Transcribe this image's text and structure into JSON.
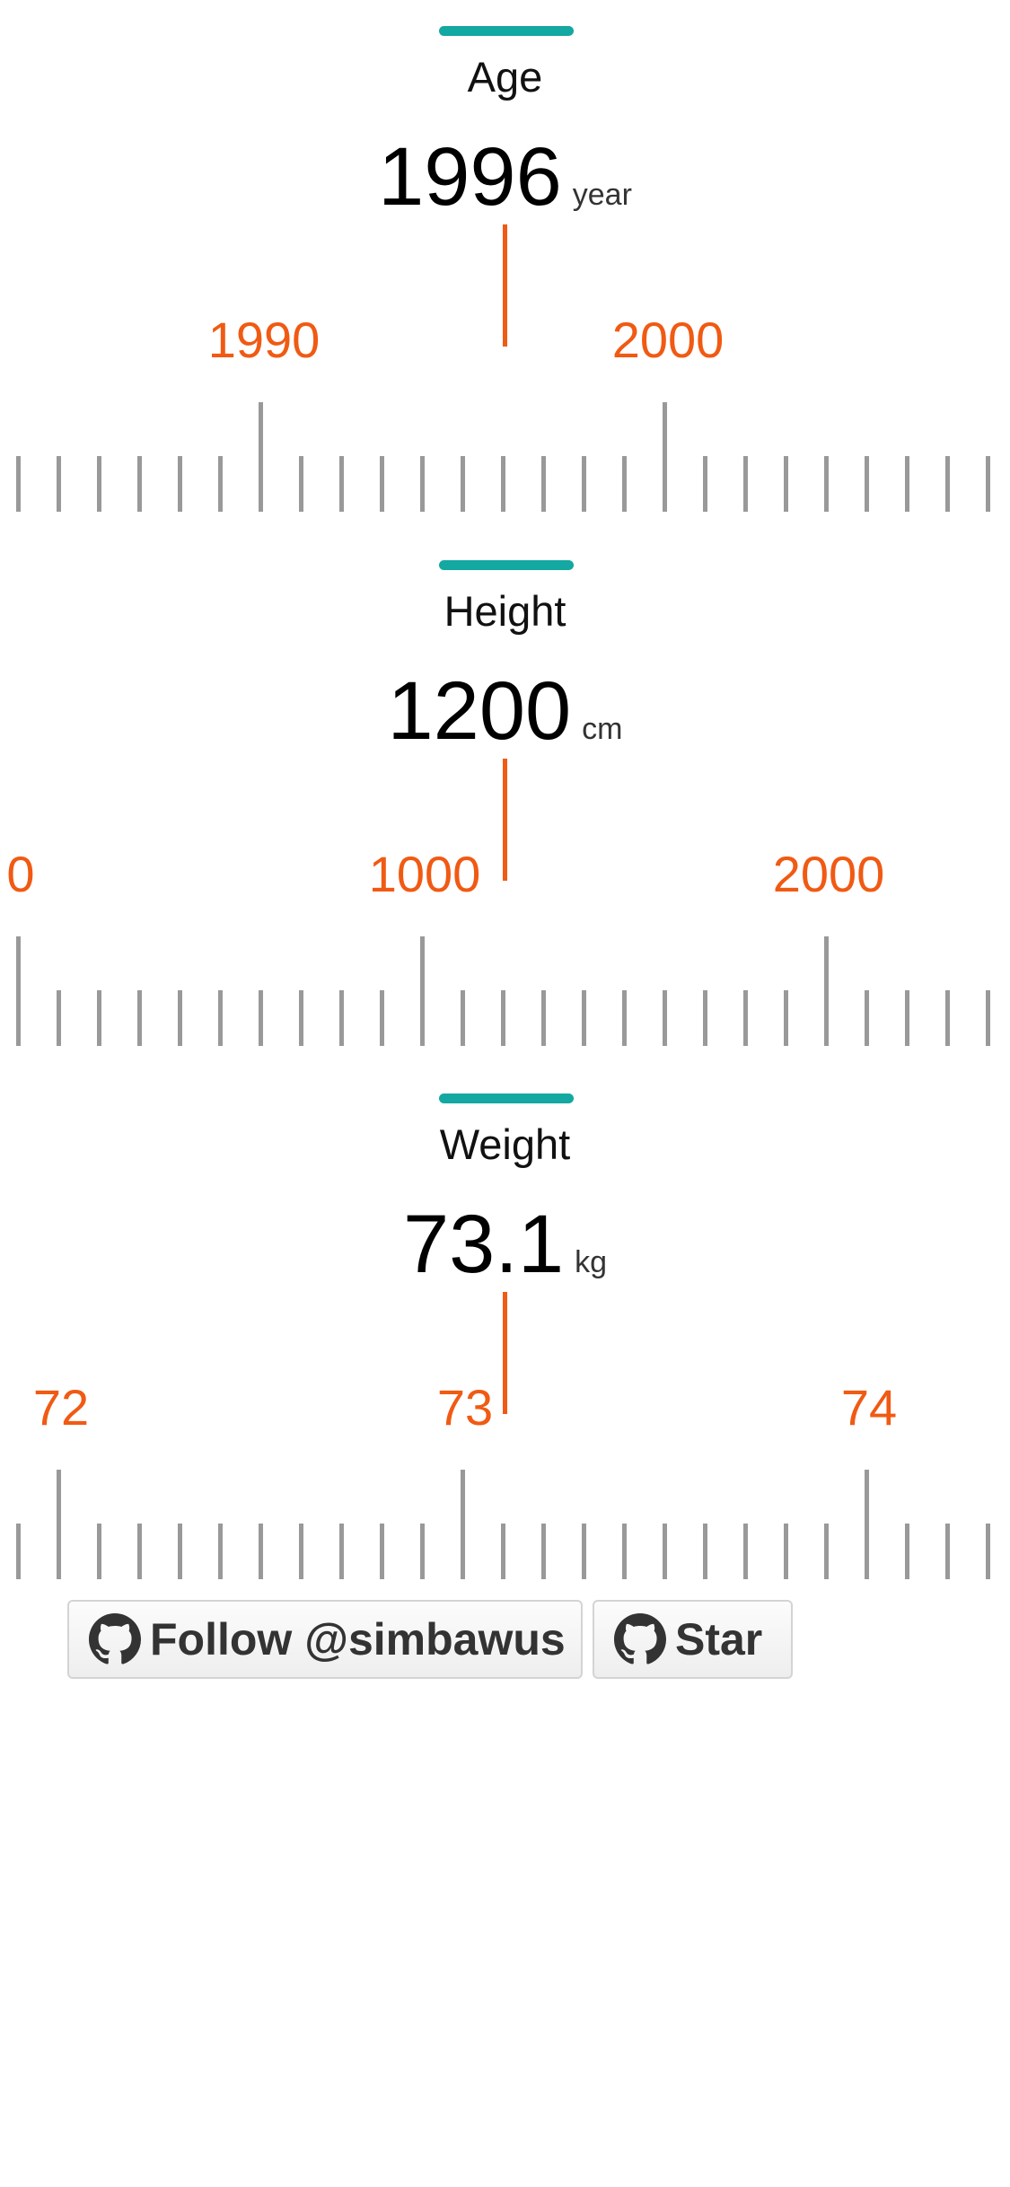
{
  "colors": {
    "accent": "#13a8a1",
    "pointer": "#f05a13",
    "tick": "#999999",
    "label": "#f05a13"
  },
  "rulers": [
    {
      "title": "Age",
      "value": "1996",
      "unit": "year",
      "labels": [
        "1990",
        "2000"
      ]
    },
    {
      "title": "Height",
      "value": "1200",
      "unit": "cm",
      "labels": [
        "0",
        "1000",
        "2000"
      ]
    },
    {
      "title": "Weight",
      "value": "73.1",
      "unit": "kg",
      "labels": [
        "72",
        "73",
        "74"
      ]
    }
  ],
  "github": {
    "follow_label": "Follow @simbawus",
    "star_label": "Star",
    "icon": "github-icon"
  }
}
